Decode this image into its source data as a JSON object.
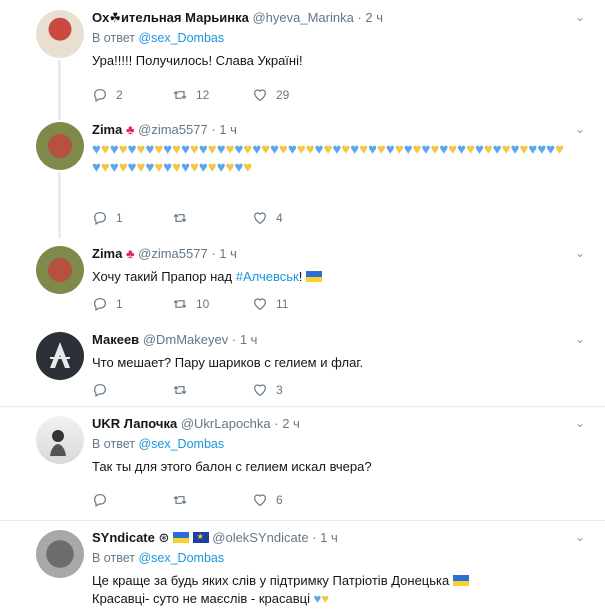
{
  "tweets": [
    {
      "name": "Ох☘ительная Марьинка",
      "handle": "@hyeva_Marinka",
      "time": "· 2 ч",
      "reply_prefix": "В ответ",
      "reply_to": "@sex_Dombas",
      "text": "Ура!!!!! Получилось! Слава Україні!",
      "replies": "2",
      "retweets": "12",
      "likes": "29"
    },
    {
      "name": "Zima",
      "handle": "@zima5577",
      "time": "· 1 ч",
      "hearts_pattern": "bybybybybybybybybybybybyybybybybybybybybybybybybybbbybybybybybybybybyby",
      "replies": "1",
      "retweets": "",
      "likes": "4"
    },
    {
      "name": "Zima",
      "handle": "@zima5577",
      "time": "· 1 ч",
      "text_prefix": "Хочу такий Прапор над ",
      "hashtag": "#Алчевськ",
      "text_suffix": "!",
      "replies": "1",
      "retweets": "10",
      "likes": "11"
    },
    {
      "name": "Макеев",
      "handle": "@DmMakeyev",
      "time": "· 1 ч",
      "text": "Что мешает? Пару шариков с гелием и флаг.",
      "replies": "",
      "retweets": "",
      "likes": "3"
    },
    {
      "name": "UKR Лапочка",
      "handle": "@UkrLapochka",
      "time": "· 2 ч",
      "reply_prefix": "В ответ",
      "reply_to": "@sex_Dombas",
      "text": "Так ты для этого балон с гелием искал вчера?",
      "replies": "",
      "retweets": "",
      "likes": "6"
    },
    {
      "name": "SYndicate",
      "handle": "@olekSYndicate",
      "time": "· 1 ч",
      "reply_prefix": "В ответ",
      "reply_to": "@sex_Dombas",
      "text_line1": "Це краще за будь яких слів у підтримку Патріотів Донецька",
      "text_line2": "Красавці- суто не маєслів - красавці"
    }
  ],
  "colors": {
    "blue_heart": "#5aa8ea",
    "yellow_heart": "#f2c744",
    "link": "#1b95e0",
    "muted": "#657786"
  },
  "icons": [
    "reply-icon",
    "retweet-icon",
    "like-icon",
    "chevron-down-icon",
    "maple-leaf-icon",
    "ukraine-flag-icon",
    "eu-flag-icon",
    "verified-icon"
  ]
}
